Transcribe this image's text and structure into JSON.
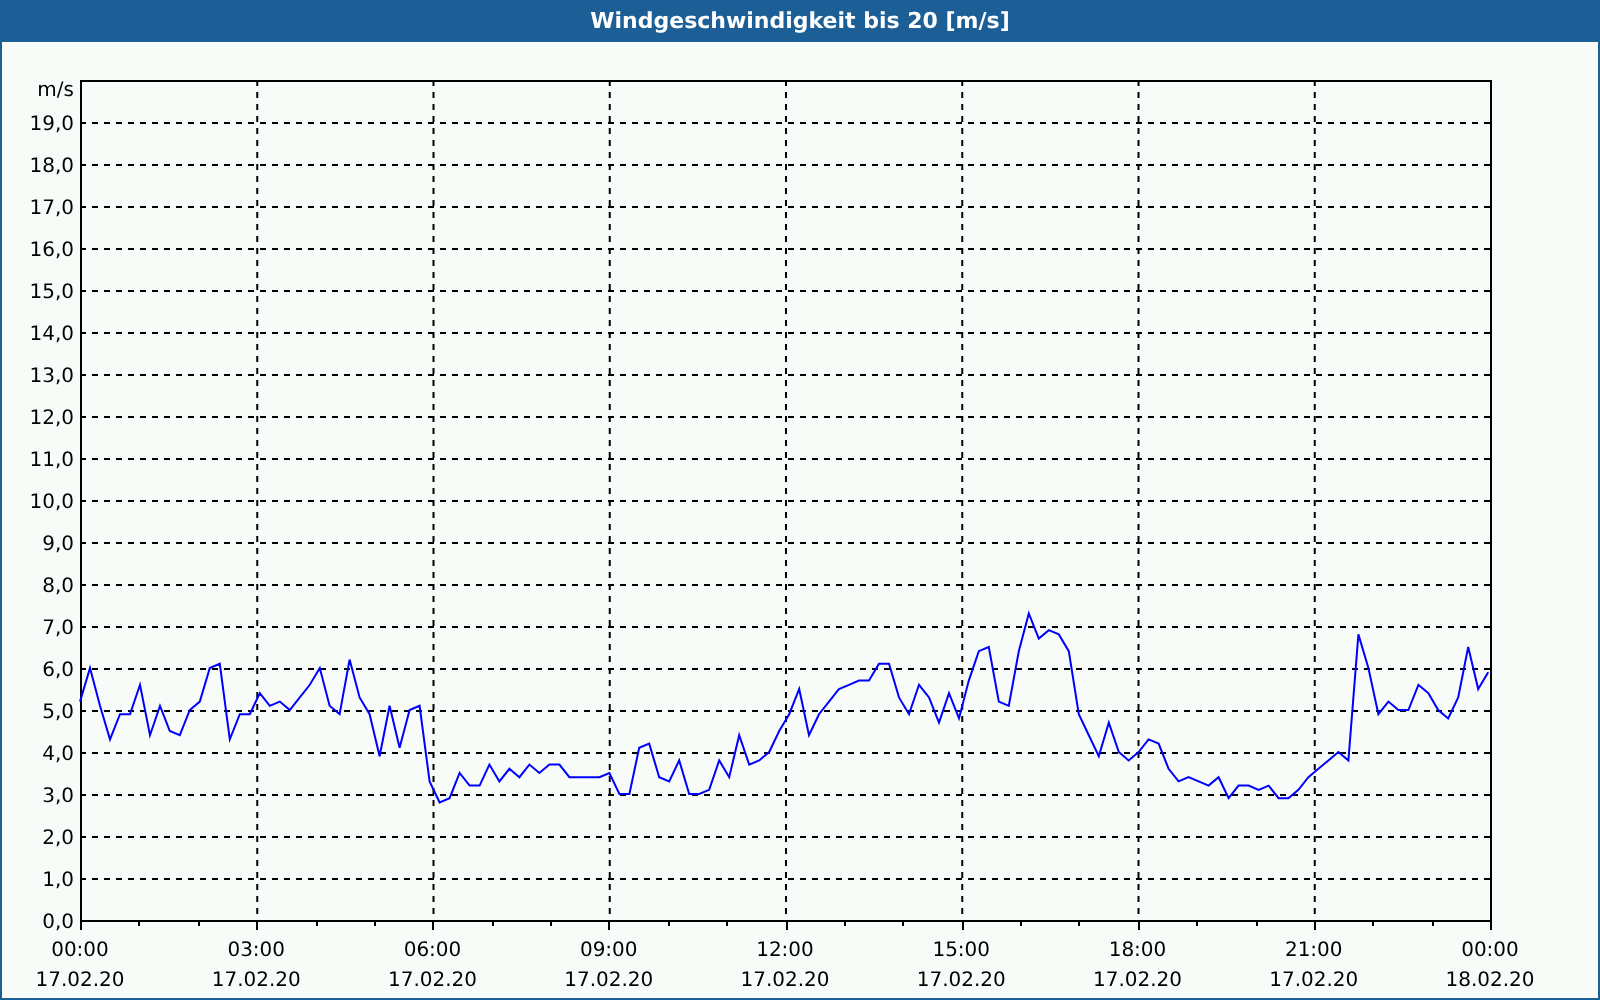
{
  "chart_data": {
    "type": "line",
    "title": "Windgeschwindigkeit bis 20 [m/s]",
    "ylabel": "m/s",
    "xlim": [
      0,
      24
    ],
    "ylim": [
      0,
      20
    ],
    "yticks": [
      {
        "value": 0,
        "label": "0,0"
      },
      {
        "value": 1,
        "label": "1,0"
      },
      {
        "value": 2,
        "label": "2,0"
      },
      {
        "value": 3,
        "label": "3,0"
      },
      {
        "value": 4,
        "label": "4,0"
      },
      {
        "value": 5,
        "label": "5,0"
      },
      {
        "value": 6,
        "label": "6,0"
      },
      {
        "value": 7,
        "label": "7,0"
      },
      {
        "value": 8,
        "label": "8,0"
      },
      {
        "value": 9,
        "label": "9,0"
      },
      {
        "value": 10,
        "label": "10,0"
      },
      {
        "value": 11,
        "label": "11,0"
      },
      {
        "value": 12,
        "label": "12,0"
      },
      {
        "value": 13,
        "label": "13,0"
      },
      {
        "value": 14,
        "label": "14,0"
      },
      {
        "value": 15,
        "label": "15,0"
      },
      {
        "value": 16,
        "label": "16,0"
      },
      {
        "value": 17,
        "label": "17,0"
      },
      {
        "value": 18,
        "label": "18,0"
      },
      {
        "value": 19,
        "label": "19,0"
      }
    ],
    "grid": true,
    "xticks": [
      {
        "value": 0,
        "label": "00:00"
      },
      {
        "value": 3,
        "label": "03:00"
      },
      {
        "value": 6,
        "label": "06:00"
      },
      {
        "value": 9,
        "label": "09:00"
      },
      {
        "value": 12,
        "label": "12:00"
      },
      {
        "value": 15,
        "label": "15:00"
      },
      {
        "value": 18,
        "label": "18:00"
      },
      {
        "value": 21,
        "label": "21:00"
      },
      {
        "value": 24,
        "label": "00:00"
      }
    ],
    "annotations": [
      "17.02.20",
      "17.02.20",
      "17.02.20",
      "17.02.20",
      "17.02.20",
      "17.02.20",
      "17.02.20",
      "17.02.20",
      "18.02.20"
    ],
    "x": [
      0,
      0.17,
      0.34,
      0.51,
      0.68,
      0.85,
      1.02,
      1.19,
      1.36,
      1.53,
      1.7,
      1.87,
      2.04,
      2.21,
      2.38,
      2.55,
      2.72,
      2.89,
      3.06,
      3.23,
      3.4,
      3.57,
      3.74,
      3.91,
      4.08,
      4.25,
      4.42,
      4.59,
      4.76,
      4.93,
      5.1,
      5.27,
      5.44,
      5.61,
      5.78,
      5.95,
      6.12,
      6.29,
      6.46,
      6.63,
      6.8,
      6.97,
      7.14,
      7.31,
      7.48,
      7.65,
      7.82,
      7.99,
      8.16,
      8.33,
      8.5,
      8.67,
      8.84,
      9.01,
      9.18,
      9.35,
      9.52,
      9.69,
      9.86,
      10.03,
      10.2,
      10.37,
      10.54,
      10.71,
      10.88,
      11.05,
      11.22,
      11.39,
      11.56,
      11.73,
      11.9,
      12.07,
      12.24,
      12.41,
      12.58,
      12.75,
      12.92,
      13.09,
      13.26,
      13.43,
      13.6,
      13.77,
      13.94,
      14.11,
      14.28,
      14.45,
      14.62,
      14.79,
      14.96,
      15.13,
      15.3,
      15.47,
      15.64,
      15.81,
      15.98,
      16.15,
      16.32,
      16.49,
      16.66,
      16.83,
      17,
      17.17,
      17.34,
      17.51,
      17.68,
      17.85,
      18.02,
      18.19,
      18.36,
      18.53,
      18.7,
      18.87,
      19.04,
      19.21,
      19.38,
      19.55,
      19.72,
      19.89,
      20.06,
      20.23,
      20.4,
      20.57,
      20.74,
      20.91,
      21.08,
      21.25,
      21.42,
      21.59,
      21.76,
      21.93,
      22.1,
      22.27,
      22.44,
      22.61,
      22.78,
      22.95,
      23.12,
      23.29,
      23.46,
      23.63,
      23.8,
      23.97
    ],
    "series": [
      {
        "color": "#0000ff",
        "values": [
          5.2,
          6.0,
          5.1,
          4.3,
          4.9,
          4.9,
          5.6,
          4.4,
          5.1,
          4.5,
          4.4,
          5.0,
          5.2,
          6.0,
          6.1,
          4.3,
          4.9,
          4.9,
          5.4,
          5.1,
          5.2,
          5.0,
          5.3,
          5.6,
          6.0,
          5.1,
          4.9,
          6.2,
          5.3,
          4.9,
          3.9,
          5.1,
          4.1,
          5.0,
          5.1,
          3.3,
          2.8,
          2.9,
          3.5,
          3.2,
          3.2,
          3.7,
          3.3,
          3.6,
          3.4,
          3.7,
          3.5,
          3.7,
          3.7,
          3.4,
          3.4,
          3.4,
          3.4,
          3.5,
          3.0,
          3.0,
          4.1,
          4.2,
          3.4,
          3.3,
          3.8,
          3.0,
          3.0,
          3.1,
          3.8,
          3.4,
          4.4,
          3.7,
          3.8,
          4.0,
          4.5,
          4.9,
          5.5,
          4.4,
          4.9,
          5.2,
          5.5,
          5.6,
          5.7,
          5.7,
          6.1,
          6.1,
          5.3,
          4.9,
          5.6,
          5.3,
          4.7,
          5.4,
          4.8,
          5.7,
          6.4,
          6.5,
          5.2,
          5.1,
          6.4,
          7.3,
          6.7,
          6.9,
          6.8,
          6.4,
          4.9,
          4.4,
          3.9,
          4.7,
          4.0,
          3.8,
          4.0,
          4.3,
          4.2,
          3.6,
          3.3,
          3.4,
          3.3,
          3.2,
          3.4,
          2.9,
          3.2,
          3.2,
          3.1,
          3.2,
          2.9,
          2.9,
          3.1,
          3.4,
          3.6,
          3.8,
          4.0,
          3.8,
          6.8,
          6.0,
          4.9,
          5.2,
          5.0,
          5.0,
          5.6,
          5.4,
          5.0,
          4.8,
          5.3,
          6.5,
          5.5,
          5.9
        ]
      }
    ]
  }
}
